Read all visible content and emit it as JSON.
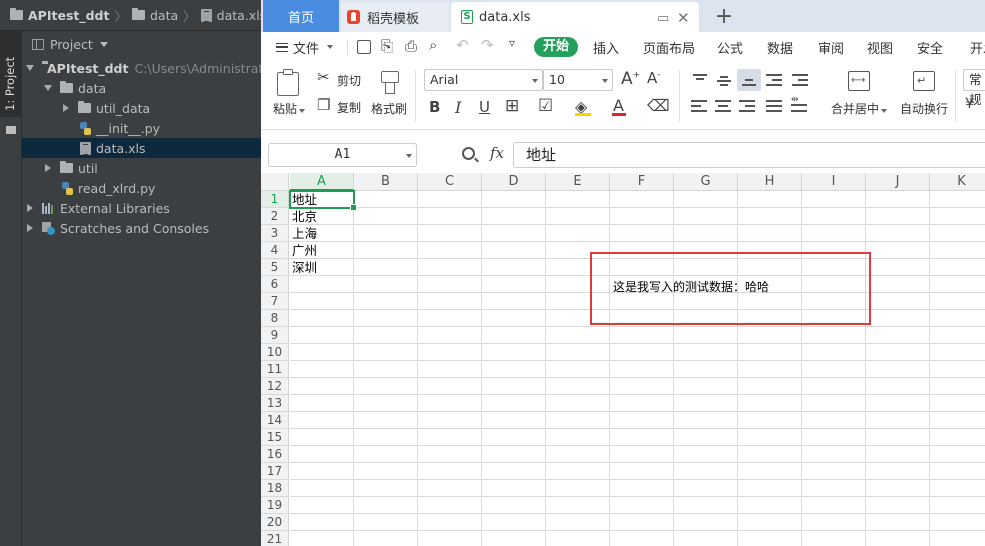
{
  "ide": {
    "breadcrumb": [
      "APItest_ddt",
      "data",
      "data.xls"
    ],
    "tool_window_tab": "1: Project",
    "project_header": "Project",
    "tree": [
      {
        "label": "APItest_ddt",
        "path": "C:\\Users\\Administrator",
        "icon": "folder-icon",
        "expanded": true
      },
      {
        "label": "data",
        "icon": "folder-icon",
        "expanded": true
      },
      {
        "label": "util_data",
        "icon": "folder-icon",
        "expanded": false
      },
      {
        "label": "__init__.py",
        "icon": "python-file-icon"
      },
      {
        "label": "data.xls",
        "icon": "spreadsheet-file-icon",
        "selected": true
      },
      {
        "label": "util",
        "icon": "folder-icon",
        "expanded": false
      },
      {
        "label": "read_xlrd.py",
        "icon": "python-file-icon"
      },
      {
        "label": "External Libraries",
        "icon": "libraries-icon",
        "expanded": false
      },
      {
        "label": "Scratches and Consoles",
        "icon": "scratches-icon",
        "expanded": false
      }
    ]
  },
  "wps": {
    "tabs": {
      "home": "首页",
      "template": "稻壳模板",
      "file": "data.xls",
      "new": "+"
    },
    "menu": {
      "file": "文件",
      "start": "开始",
      "items": [
        "插入",
        "页面布局",
        "公式",
        "数据",
        "审阅",
        "视图",
        "安全",
        "开发"
      ]
    },
    "ribbon": {
      "paste": "粘贴",
      "cut": "剪切",
      "copy": "复制",
      "format_painter": "格式刷",
      "font_name": "Arial",
      "font_size": "10",
      "merge_center": "合并居中",
      "wrap_text": "自动换行",
      "number_format": "常规"
    },
    "formula_bar": {
      "name_box": "A1",
      "fx": "fx",
      "content": "地址"
    },
    "sheet": {
      "columns": [
        "A",
        "B",
        "C",
        "D",
        "E",
        "F",
        "G",
        "H",
        "I",
        "J",
        "K"
      ],
      "rows": [
        "1",
        "2",
        "3",
        "4",
        "5",
        "6",
        "7",
        "8",
        "9",
        "10",
        "11",
        "12",
        "13",
        "14",
        "15",
        "16",
        "17",
        "18",
        "19",
        "20",
        "21"
      ],
      "active_column": "A",
      "active_row": "1",
      "cells_a": [
        "地址",
        "北京",
        "上海",
        "广州",
        "深圳"
      ],
      "annotation": "这是我写入的测试数据：哈哈"
    }
  },
  "colors": {
    "ide_bg": "#3c3f41",
    "ide_selection": "#0d293e",
    "wps_accent_green": "#1e9e54",
    "wps_home_tab": "#4a8de0",
    "annotation_border": "#e0393e"
  }
}
